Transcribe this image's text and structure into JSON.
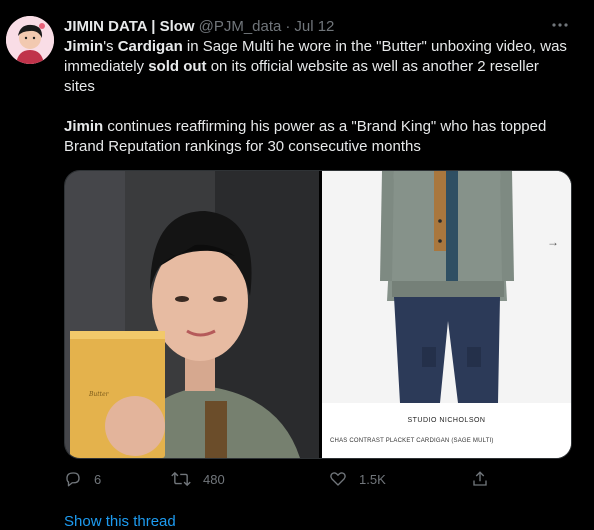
{
  "tweet": {
    "author": {
      "display_name": "JIMIN DATA | Slow",
      "handle": "@PJM_data",
      "separator": "·",
      "time": "Jul 12",
      "avatar_icon": "avatar-illustration"
    },
    "body": {
      "p1": {
        "s1": "Jimin",
        "s2": "'s ",
        "s3": "Cardigan",
        "s4": " in Sage Multi he wore in the \"Butter\" unboxing video, was immediately ",
        "s5": "sold out",
        "s6": " on its official website as well as another 2 reseller sites"
      },
      "p2": {
        "s1": "Jimin",
        "s2": " continues reaffirming his power as a \"Brand King\" who has topped Brand Reputation rankings for 30 consecutive months"
      }
    },
    "media": {
      "right_photo": {
        "brand_caption": "STUDIO NICHOLSON",
        "product_caption": "CHAS CONTRAST PLACKET CARDIGAN (SAGE MULTI)",
        "next_arrow": "→"
      },
      "left_photo": {
        "box_label": "Butter"
      }
    },
    "actions": {
      "reply_count": "6",
      "retweet_count": "480",
      "like_count": "1.5K",
      "icons": [
        "reply-icon",
        "retweet-icon",
        "like-icon",
        "share-icon"
      ]
    },
    "show_thread": "Show this thread"
  },
  "colors": {
    "background": "#000000",
    "text_primary": "#e7e9ea",
    "text_secondary": "#71767b",
    "link": "#1d9bf0",
    "border": "#2f3336"
  }
}
